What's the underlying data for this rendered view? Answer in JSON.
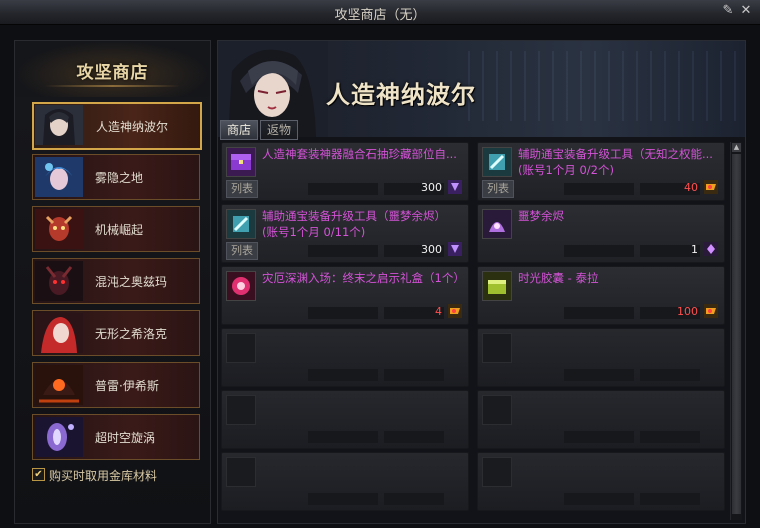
{
  "window": {
    "title": "攻坚商店（无）"
  },
  "left": {
    "title": "攻坚商店",
    "npcs": [
      {
        "label": "人造神纳波尔"
      },
      {
        "label": "雾隐之地"
      },
      {
        "label": "机械崛起"
      },
      {
        "label": "混沌之奥兹玛"
      },
      {
        "label": "无形之希洛克"
      },
      {
        "label": "普雷·伊希斯"
      },
      {
        "label": "超时空旋涡"
      }
    ],
    "buy_option": {
      "label": "购买时取用金库材料",
      "checked": true
    }
  },
  "banner": {
    "title": "人造神纳波尔"
  },
  "tabs": {
    "shop": "商店",
    "redeem": "返物"
  },
  "items": [
    {
      "name": "人造神套装神器融合石抽珍藏部位自...",
      "name2": "",
      "tag": "列表",
      "price": "300",
      "price_color": "white",
      "icon": "chest-icon",
      "currency": "purple-token-icon"
    },
    {
      "name": "辅助通宝装备升级工具（无知之权能...",
      "name2": "(账号1个月 0/2个)",
      "tag": "列表",
      "price": "40",
      "price_color": "red",
      "icon": "upgrade-tool-icon",
      "currency": "gold-ticket-icon"
    },
    {
      "name": "辅助通宝装备升级工具（噩梦余烬）",
      "name2": "(账号1个月 0/11个)",
      "tag": "列表",
      "price": "300",
      "price_color": "white",
      "icon": "upgrade-tool-icon",
      "currency": "purple-token-icon"
    },
    {
      "name": "噩梦余烬",
      "name2": "",
      "tag": "",
      "price": "1",
      "price_color": "white",
      "icon": "nightmare-ember-icon",
      "currency": "purple-crystal-icon"
    },
    {
      "name": "灾厄深渊入场：终末之启示礼盒（1个）",
      "name2": "",
      "tag": "",
      "price": "4",
      "price_color": "red",
      "icon": "orb-icon",
      "currency": "gold-ticket-icon"
    },
    {
      "name": "时光胶囊 - 泰拉",
      "name2": "",
      "tag": "",
      "price": "100",
      "price_color": "red",
      "icon": "capsule-icon",
      "currency": "gold-ticket-icon"
    }
  ],
  "colors": {
    "accent_gold": "#d4a64a",
    "item_name": "#d453d6",
    "price_red": "#ff4f4f"
  }
}
